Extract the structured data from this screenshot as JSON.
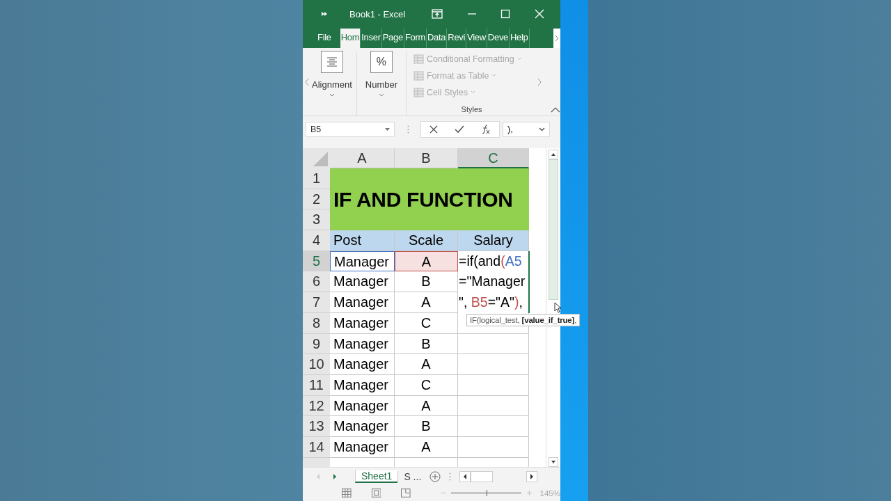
{
  "window": {
    "title": "Book1  -  Excel"
  },
  "ribbon_tabs": [
    {
      "label": "File",
      "selected": false
    },
    {
      "label": "Hom",
      "selected": true
    },
    {
      "label": "Inser",
      "selected": false
    },
    {
      "label": "Page",
      "selected": false
    },
    {
      "label": "Form",
      "selected": false
    },
    {
      "label": "Data",
      "selected": false
    },
    {
      "label": "Revi",
      "selected": false
    },
    {
      "label": "View",
      "selected": false
    },
    {
      "label": "Deve",
      "selected": false
    },
    {
      "label": "Help",
      "selected": false
    }
  ],
  "ribbon_groups": [
    {
      "kind": "big",
      "label": "Alignment"
    },
    {
      "kind": "big",
      "label": "Number",
      "icon_text": "%"
    },
    {
      "kind": "list",
      "label": "Styles",
      "items": [
        {
          "label": "Conditional Formatting",
          "disabled": true
        },
        {
          "label": "Format as Table",
          "disabled": true
        },
        {
          "label": "Cell Styles",
          "disabled": true
        }
      ]
    }
  ],
  "formula_bar": {
    "name_box": "B5",
    "formula": "),"
  },
  "columns": [
    {
      "label": "A",
      "selected": false
    },
    {
      "label": "B",
      "selected": false
    },
    {
      "label": "C",
      "selected": true
    }
  ],
  "title_cell": "IF AND FUNCTION",
  "rows": [
    {
      "number": "1",
      "selected": false
    },
    {
      "number": "2",
      "selected": false
    },
    {
      "number": "3",
      "selected": false
    },
    {
      "number": "4",
      "selected": false,
      "kind": "header",
      "cells": [
        {
          "text": "Post"
        },
        {
          "text": "Scale"
        },
        {
          "text": "Salary"
        }
      ]
    },
    {
      "number": "5",
      "selected": true,
      "cells": [
        {
          "text": "Manager",
          "color": "#4472c4"
        },
        {
          "text": "A",
          "color": "#c0504d"
        }
      ]
    },
    {
      "number": "6",
      "selected": false,
      "cells": [
        {
          "text": "Manager"
        },
        {
          "text": "B"
        }
      ]
    },
    {
      "number": "7",
      "selected": false,
      "cells": [
        {
          "text": "Manager"
        },
        {
          "text": "A"
        }
      ]
    },
    {
      "number": "8",
      "selected": false,
      "cells": [
        {
          "text": "Manager"
        },
        {
          "text": "C"
        }
      ]
    },
    {
      "number": "9",
      "selected": false,
      "cells": [
        {
          "text": "Manager"
        },
        {
          "text": "B"
        }
      ]
    },
    {
      "number": "10",
      "selected": false,
      "cells": [
        {
          "text": "Manager"
        },
        {
          "text": "A"
        }
      ]
    },
    {
      "number": "11",
      "selected": false,
      "cells": [
        {
          "text": "Manager"
        },
        {
          "text": "C"
        }
      ]
    },
    {
      "number": "12",
      "selected": false,
      "cells": [
        {
          "text": "Manager"
        },
        {
          "text": "A"
        }
      ]
    },
    {
      "number": "13",
      "selected": false,
      "cells": [
        {
          "text": "Manager"
        },
        {
          "text": "B"
        }
      ]
    },
    {
      "number": "14",
      "selected": false,
      "cells": [
        {
          "text": "Manager"
        },
        {
          "text": "A"
        }
      ]
    }
  ],
  "cell_editor": {
    "lines": [
      [
        {
          "text": "=if(and"
        },
        {
          "text": "(",
          "color": "#c0504d"
        },
        {
          "text": "A5",
          "color": "#4472c4"
        }
      ],
      [
        {
          "text": "=\"Manager"
        }
      ],
      [
        {
          "text": "\", "
        },
        {
          "text": "B5",
          "color": "#c0504d"
        },
        {
          "text": "=\"A\""
        },
        {
          "text": ")",
          "color": "#c0504d"
        },
        {
          "text": ","
        }
      ]
    ]
  },
  "tooltip": "IF(logical_test, **[value_if_true]**,",
  "sheet_tabs": [
    {
      "label": "Sheet1",
      "selected": true
    },
    {
      "label": "S ...",
      "selected": false
    }
  ],
  "status_bar": {
    "zoom": {
      "level": 0.5,
      "reading": "145%"
    }
  }
}
